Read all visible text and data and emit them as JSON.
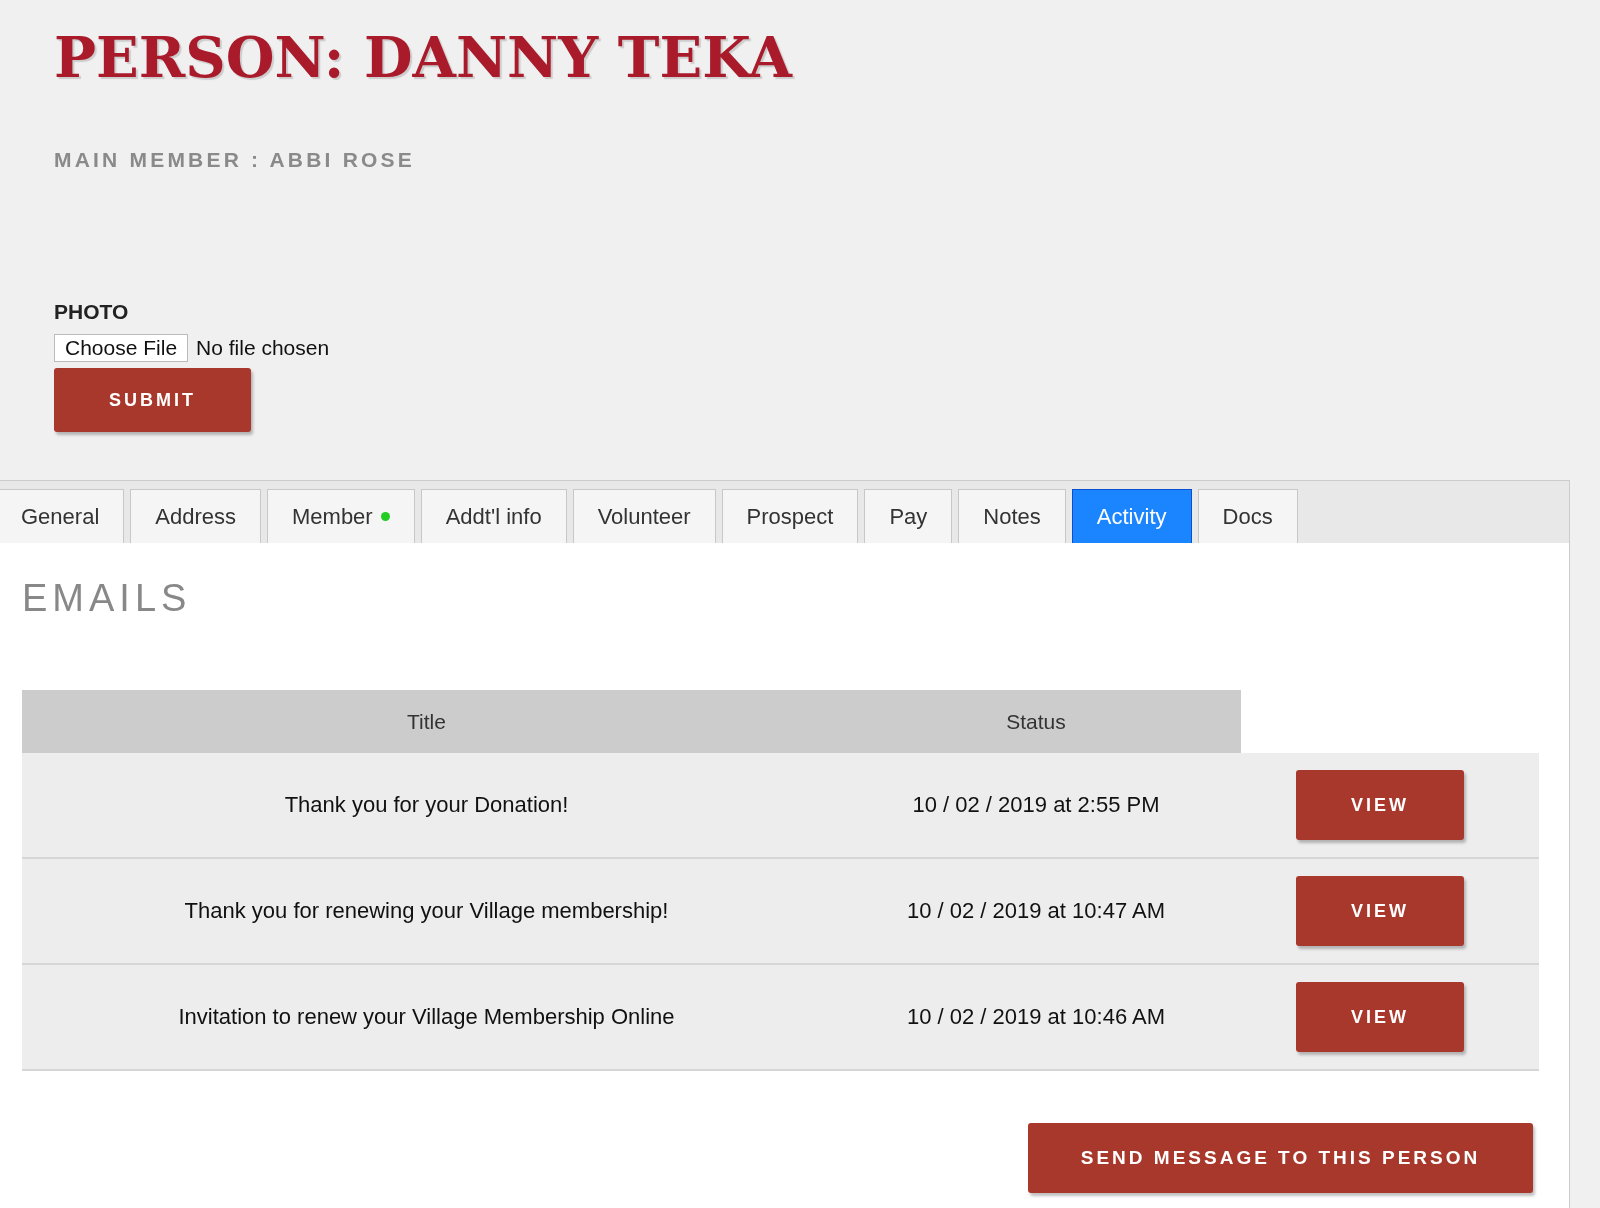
{
  "page_title": "PERSON: DANNY TEKA",
  "subtitle": "MAIN MEMBER : ABBI ROSE",
  "photo": {
    "label": "PHOTO",
    "choose_button": "Choose File",
    "file_status": "No file chosen",
    "submit": "SUBMIT"
  },
  "tabs": [
    {
      "label": "General",
      "selected": false
    },
    {
      "label": "Address",
      "selected": false
    },
    {
      "label": "Member",
      "selected": false,
      "color": "#22cc22"
    },
    {
      "label": "Addt'l info",
      "selected": false
    },
    {
      "label": "Volunteer",
      "selected": false
    },
    {
      "label": "Prospect",
      "selected": false
    },
    {
      "label": "Pay",
      "selected": false
    },
    {
      "label": "Notes",
      "selected": false
    },
    {
      "label": "Activity",
      "selected": true
    },
    {
      "label": "Docs",
      "selected": false
    }
  ],
  "section_title": "EMAILS",
  "table": {
    "columns": [
      "Title",
      "Status"
    ],
    "rows": [
      {
        "title": "Thank you for your Donation!",
        "status": "10 / 02 / 2019 at 2:55 PM",
        "action": "VIEW"
      },
      {
        "title": "Thank you for renewing your Village membership!",
        "status": "10 / 02 / 2019 at 10:47 AM",
        "action": "VIEW"
      },
      {
        "title": "Invitation to renew your Village Membership Online",
        "status": "10 / 02 / 2019 at 10:46 AM",
        "action": "VIEW"
      }
    ]
  },
  "send_button": "SEND MESSAGE TO THIS PERSON"
}
